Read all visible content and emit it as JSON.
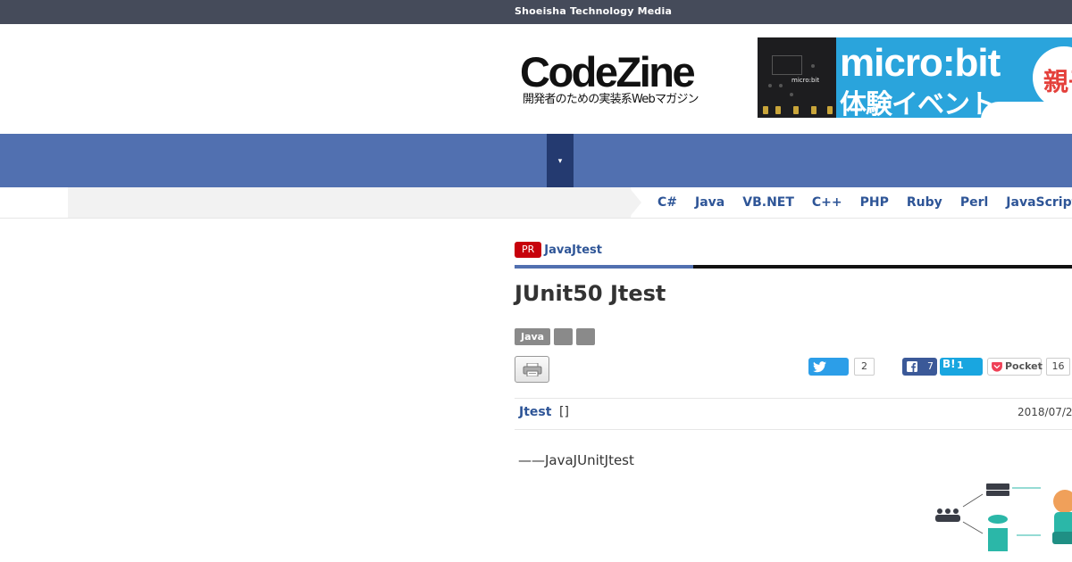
{
  "topbar": {
    "brand": "Shoeisha Technology Media"
  },
  "header": {
    "logo_main": "CodeZine",
    "logo_sub": "開発者のための実装系Webマガジン"
  },
  "ad": {
    "board_label": "micro:bit",
    "title": "micro:bit",
    "subtitle": "体験イベント",
    "badge": "親子"
  },
  "navbar": {
    "menu_toggle": "▾"
  },
  "subnav": {
    "languages": [
      "C#",
      "Java",
      "VB.NET",
      "C++",
      "PHP",
      "Ruby",
      "Perl",
      "JavaScript"
    ]
  },
  "article": {
    "pr_badge": "PR",
    "category": "JavaJtest",
    "title": "JUnit50 Jtest",
    "tags": [
      "Java",
      "",
      ""
    ],
    "author": "Jtest",
    "author_note": "[]",
    "date": "2018/07/2",
    "lead": "——JavaJUnitJtest"
  },
  "share": {
    "twitter_count": "2",
    "facebook_count": "7",
    "hatena_label": "B!",
    "hatena_count": "1",
    "pocket_label": "Pocket",
    "pocket_count": "16"
  },
  "colors": {
    "topbar": "#454b5a",
    "navbar": "#5170b0",
    "nav_toggle": "#243a70",
    "link": "#2e5597",
    "pr_red": "#c7000b",
    "twitter": "#2c9ee8",
    "facebook": "#3b5998",
    "hatena": "#19a6e0",
    "pocket": "#ef4056"
  }
}
